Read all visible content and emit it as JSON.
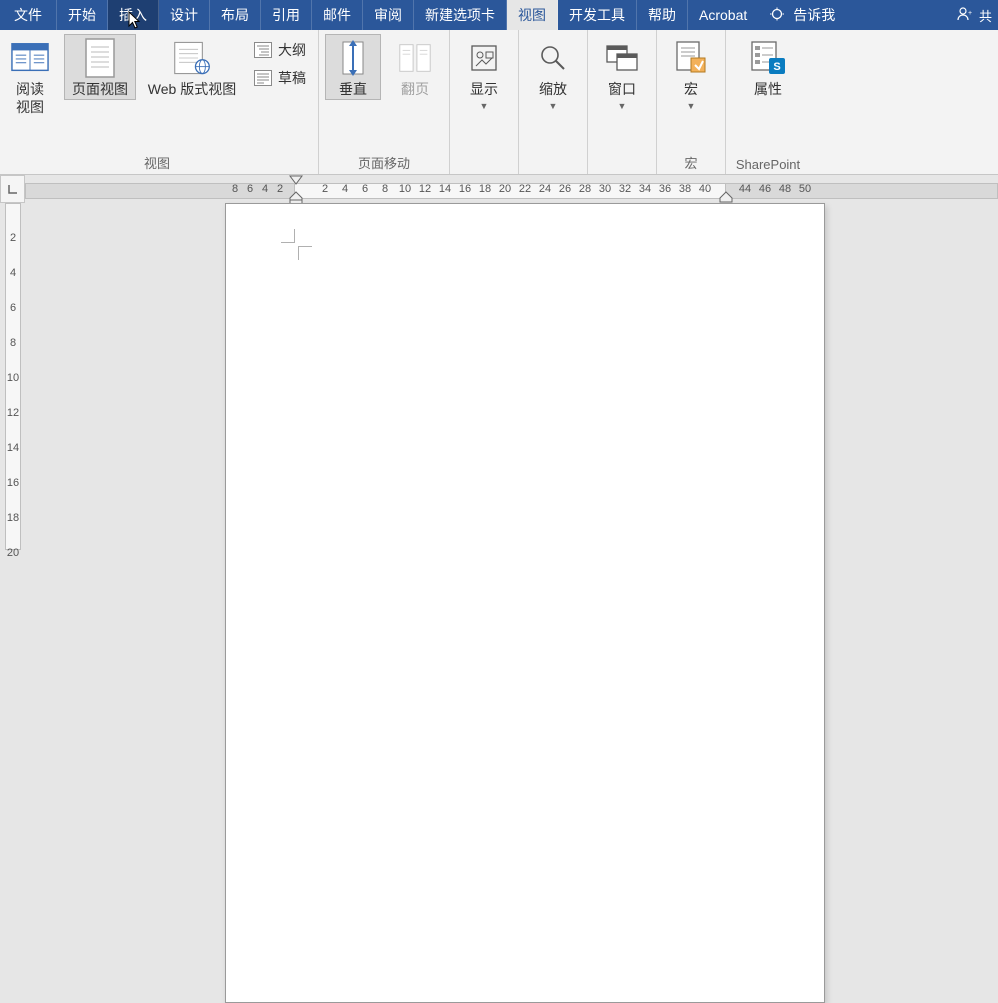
{
  "tabs": {
    "file": "文件",
    "home": "开始",
    "insert": "插入",
    "design": "设计",
    "layout": "布局",
    "references": "引用",
    "mail": "邮件",
    "review": "审阅",
    "newtab": "新建选项卡",
    "view": "视图",
    "devtools": "开发工具",
    "help": "帮助",
    "acrobat": "Acrobat",
    "tellme": "告诉我",
    "share": "共"
  },
  "ribbon": {
    "views_group": "视图",
    "read_view": "阅读\n视图",
    "page_view": "页面视图",
    "web": "Web 版式视图",
    "outline": "大纲",
    "draft": "草稿",
    "pagemove_group": "页面移动",
    "vertical": "垂直",
    "flip": "翻页",
    "show": "显示",
    "zoom": "缩放",
    "window": "窗口",
    "macros_group": "宏",
    "macros": "宏",
    "sharepoint_group": "SharePoint",
    "properties": "属性"
  },
  "ruler": {
    "h": [
      "8",
      "6",
      "4",
      "2",
      "2",
      "4",
      "6",
      "8",
      "10",
      "12",
      "14",
      "16",
      "18",
      "20",
      "22",
      "24",
      "26",
      "28",
      "30",
      "32",
      "34",
      "36",
      "38",
      "40",
      "44",
      "46",
      "48",
      "50"
    ],
    "v": [
      "2",
      "4",
      "6",
      "8",
      "10",
      "12",
      "14",
      "16",
      "18",
      "20"
    ]
  },
  "colors": {
    "accent": "#2b579a"
  }
}
